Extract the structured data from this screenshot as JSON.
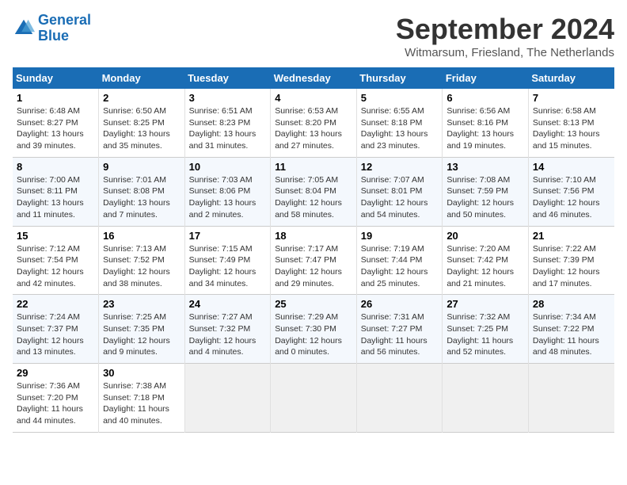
{
  "logo": {
    "line1": "General",
    "line2": "Blue"
  },
  "title": "September 2024",
  "subtitle": "Witmarsum, Friesland, The Netherlands",
  "headers": [
    "Sunday",
    "Monday",
    "Tuesday",
    "Wednesday",
    "Thursday",
    "Friday",
    "Saturday"
  ],
  "weeks": [
    [
      {
        "day": "1",
        "info": "Sunrise: 6:48 AM\nSunset: 8:27 PM\nDaylight: 13 hours\nand 39 minutes."
      },
      {
        "day": "2",
        "info": "Sunrise: 6:50 AM\nSunset: 8:25 PM\nDaylight: 13 hours\nand 35 minutes."
      },
      {
        "day": "3",
        "info": "Sunrise: 6:51 AM\nSunset: 8:23 PM\nDaylight: 13 hours\nand 31 minutes."
      },
      {
        "day": "4",
        "info": "Sunrise: 6:53 AM\nSunset: 8:20 PM\nDaylight: 13 hours\nand 27 minutes."
      },
      {
        "day": "5",
        "info": "Sunrise: 6:55 AM\nSunset: 8:18 PM\nDaylight: 13 hours\nand 23 minutes."
      },
      {
        "day": "6",
        "info": "Sunrise: 6:56 AM\nSunset: 8:16 PM\nDaylight: 13 hours\nand 19 minutes."
      },
      {
        "day": "7",
        "info": "Sunrise: 6:58 AM\nSunset: 8:13 PM\nDaylight: 13 hours\nand 15 minutes."
      }
    ],
    [
      {
        "day": "8",
        "info": "Sunrise: 7:00 AM\nSunset: 8:11 PM\nDaylight: 13 hours\nand 11 minutes."
      },
      {
        "day": "9",
        "info": "Sunrise: 7:01 AM\nSunset: 8:08 PM\nDaylight: 13 hours\nand 7 minutes."
      },
      {
        "day": "10",
        "info": "Sunrise: 7:03 AM\nSunset: 8:06 PM\nDaylight: 13 hours\nand 2 minutes."
      },
      {
        "day": "11",
        "info": "Sunrise: 7:05 AM\nSunset: 8:04 PM\nDaylight: 12 hours\nand 58 minutes."
      },
      {
        "day": "12",
        "info": "Sunrise: 7:07 AM\nSunset: 8:01 PM\nDaylight: 12 hours\nand 54 minutes."
      },
      {
        "day": "13",
        "info": "Sunrise: 7:08 AM\nSunset: 7:59 PM\nDaylight: 12 hours\nand 50 minutes."
      },
      {
        "day": "14",
        "info": "Sunrise: 7:10 AM\nSunset: 7:56 PM\nDaylight: 12 hours\nand 46 minutes."
      }
    ],
    [
      {
        "day": "15",
        "info": "Sunrise: 7:12 AM\nSunset: 7:54 PM\nDaylight: 12 hours\nand 42 minutes."
      },
      {
        "day": "16",
        "info": "Sunrise: 7:13 AM\nSunset: 7:52 PM\nDaylight: 12 hours\nand 38 minutes."
      },
      {
        "day": "17",
        "info": "Sunrise: 7:15 AM\nSunset: 7:49 PM\nDaylight: 12 hours\nand 34 minutes."
      },
      {
        "day": "18",
        "info": "Sunrise: 7:17 AM\nSunset: 7:47 PM\nDaylight: 12 hours\nand 29 minutes."
      },
      {
        "day": "19",
        "info": "Sunrise: 7:19 AM\nSunset: 7:44 PM\nDaylight: 12 hours\nand 25 minutes."
      },
      {
        "day": "20",
        "info": "Sunrise: 7:20 AM\nSunset: 7:42 PM\nDaylight: 12 hours\nand 21 minutes."
      },
      {
        "day": "21",
        "info": "Sunrise: 7:22 AM\nSunset: 7:39 PM\nDaylight: 12 hours\nand 17 minutes."
      }
    ],
    [
      {
        "day": "22",
        "info": "Sunrise: 7:24 AM\nSunset: 7:37 PM\nDaylight: 12 hours\nand 13 minutes."
      },
      {
        "day": "23",
        "info": "Sunrise: 7:25 AM\nSunset: 7:35 PM\nDaylight: 12 hours\nand 9 minutes."
      },
      {
        "day": "24",
        "info": "Sunrise: 7:27 AM\nSunset: 7:32 PM\nDaylight: 12 hours\nand 4 minutes."
      },
      {
        "day": "25",
        "info": "Sunrise: 7:29 AM\nSunset: 7:30 PM\nDaylight: 12 hours\nand 0 minutes."
      },
      {
        "day": "26",
        "info": "Sunrise: 7:31 AM\nSunset: 7:27 PM\nDaylight: 11 hours\nand 56 minutes."
      },
      {
        "day": "27",
        "info": "Sunrise: 7:32 AM\nSunset: 7:25 PM\nDaylight: 11 hours\nand 52 minutes."
      },
      {
        "day": "28",
        "info": "Sunrise: 7:34 AM\nSunset: 7:22 PM\nDaylight: 11 hours\nand 48 minutes."
      }
    ],
    [
      {
        "day": "29",
        "info": "Sunrise: 7:36 AM\nSunset: 7:20 PM\nDaylight: 11 hours\nand 44 minutes."
      },
      {
        "day": "30",
        "info": "Sunrise: 7:38 AM\nSunset: 7:18 PM\nDaylight: 11 hours\nand 40 minutes."
      },
      {
        "day": "",
        "info": ""
      },
      {
        "day": "",
        "info": ""
      },
      {
        "day": "",
        "info": ""
      },
      {
        "day": "",
        "info": ""
      },
      {
        "day": "",
        "info": ""
      }
    ]
  ]
}
